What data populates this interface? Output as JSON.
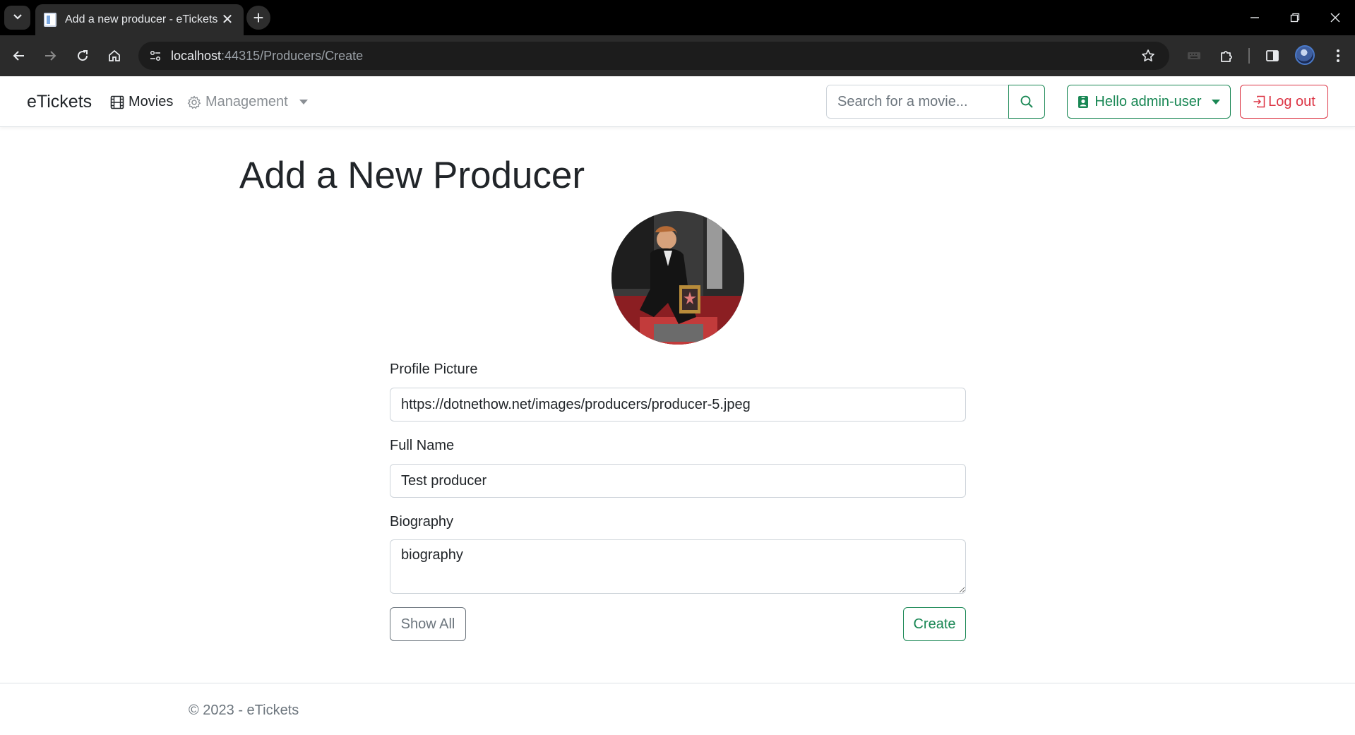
{
  "browser": {
    "tab_title": "Add a new producer - eTickets",
    "url_host": "localhost",
    "url_path": ":44315/Producers/Create"
  },
  "navbar": {
    "brand": "eTickets",
    "movies_label": "Movies",
    "management_label": "Management",
    "search_placeholder": "Search for a movie...",
    "user_label": "Hello admin-user",
    "logout_label": "Log out"
  },
  "page": {
    "title": "Add a New Producer"
  },
  "form": {
    "profile_picture_label": "Profile Picture",
    "profile_picture_value": "https://dotnethow.net/images/producers/producer-5.jpeg",
    "full_name_label": "Full Name",
    "full_name_value": "Test producer",
    "biography_label": "Biography",
    "biography_value": "biography",
    "show_all_label": "Show All",
    "create_label": "Create"
  },
  "footer": {
    "text": "© 2023 - eTickets"
  },
  "colors": {
    "success": "#198754",
    "danger": "#dc3545",
    "secondary": "#6c757d",
    "chrome_bg": "#2b2b2b"
  }
}
